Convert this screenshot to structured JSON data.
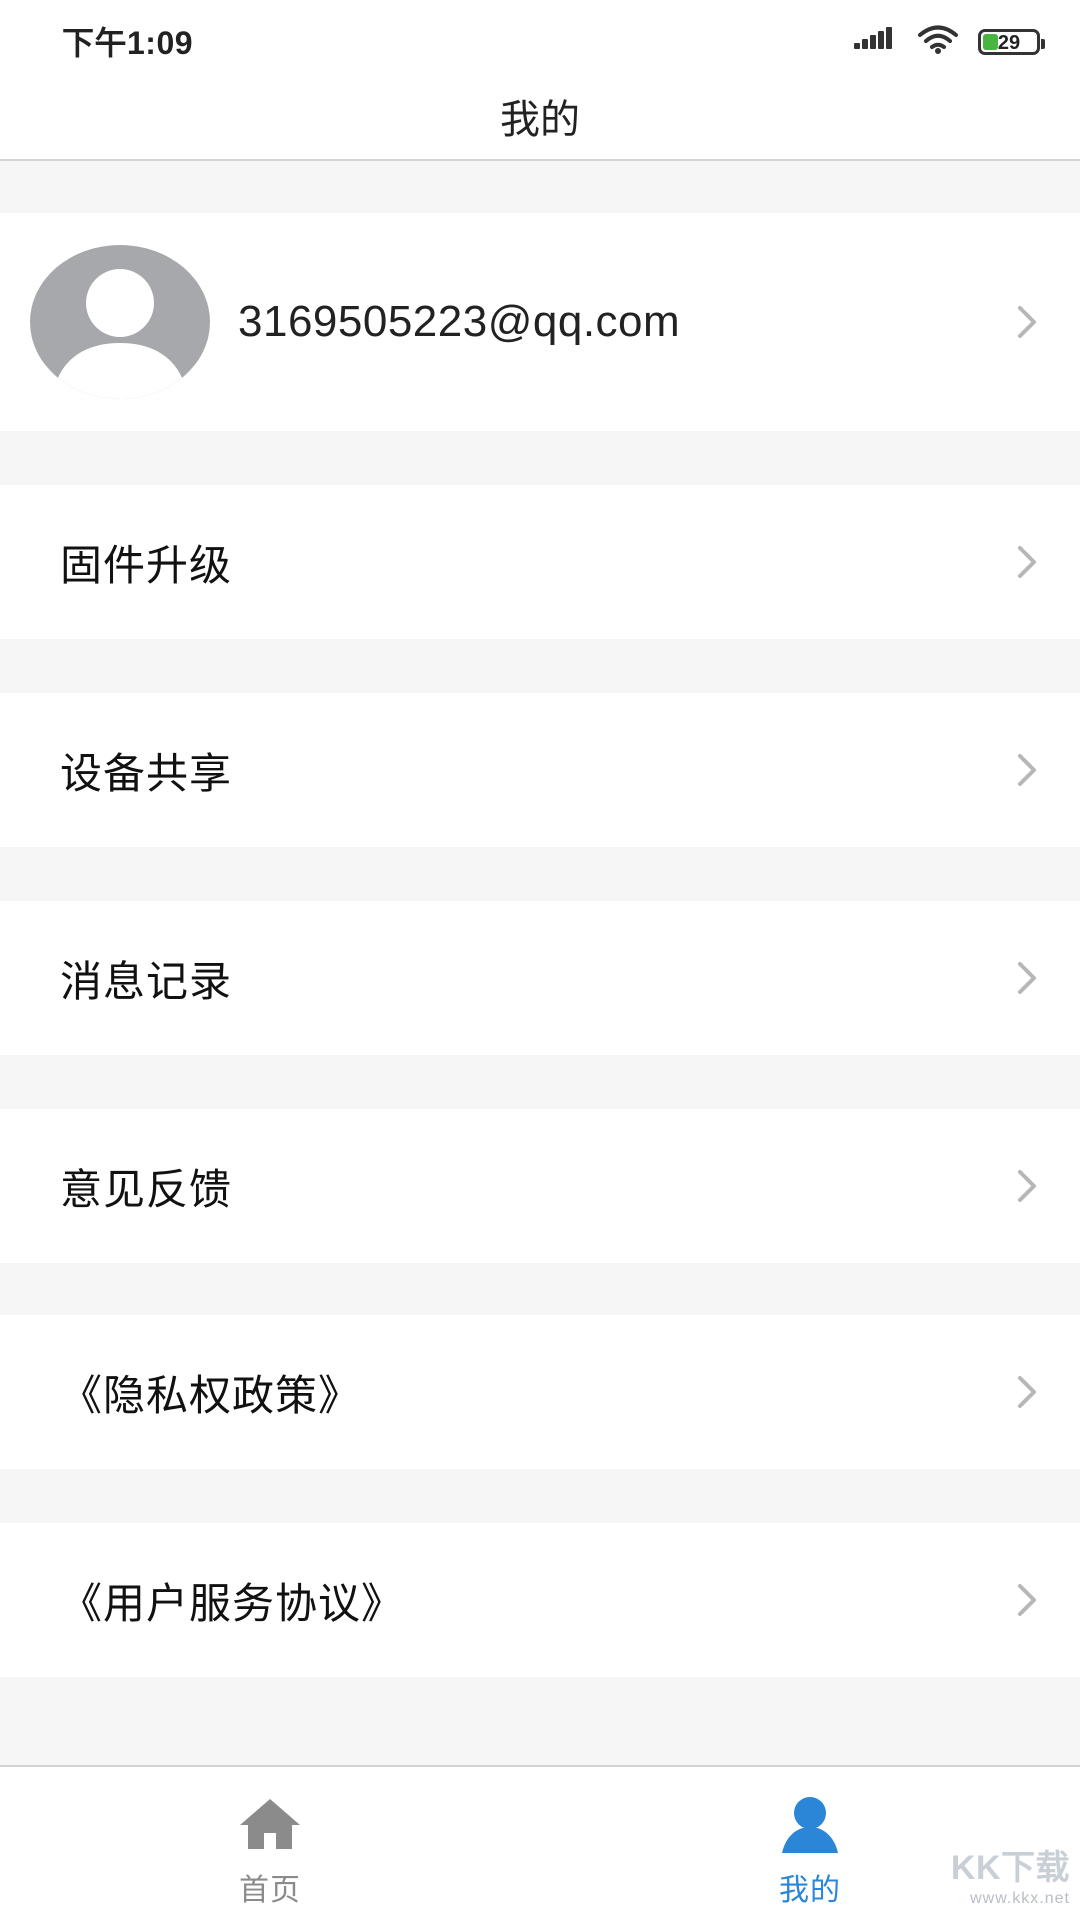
{
  "status_bar": {
    "time": "下午1:09",
    "battery_percent": "29",
    "battery_level": 0.29,
    "icons": [
      "signal-icon",
      "wifi-icon",
      "battery-icon"
    ]
  },
  "header": {
    "title": "我的"
  },
  "profile": {
    "email": "3169505223@qq.com",
    "avatar_icon": "avatar-placeholder-icon"
  },
  "menu": {
    "items": [
      {
        "label": "固件升级"
      },
      {
        "label": "设备共享"
      },
      {
        "label": "消息记录"
      },
      {
        "label": "意见反馈"
      },
      {
        "label": "《隐私权政策》"
      },
      {
        "label": "《用户服务协议》"
      }
    ]
  },
  "bottom_nav": {
    "items": [
      {
        "label": "首页",
        "icon": "home-icon",
        "active": false
      },
      {
        "label": "我的",
        "icon": "user-icon",
        "active": true
      }
    ]
  },
  "watermark": {
    "brand": "KK下载",
    "url": "www.kkx.net"
  },
  "colors": {
    "accent": "#2b86d7",
    "background": "#f6f6f6",
    "chevron": "#b7b7b7",
    "inactive_nav": "#8b8b8b"
  }
}
